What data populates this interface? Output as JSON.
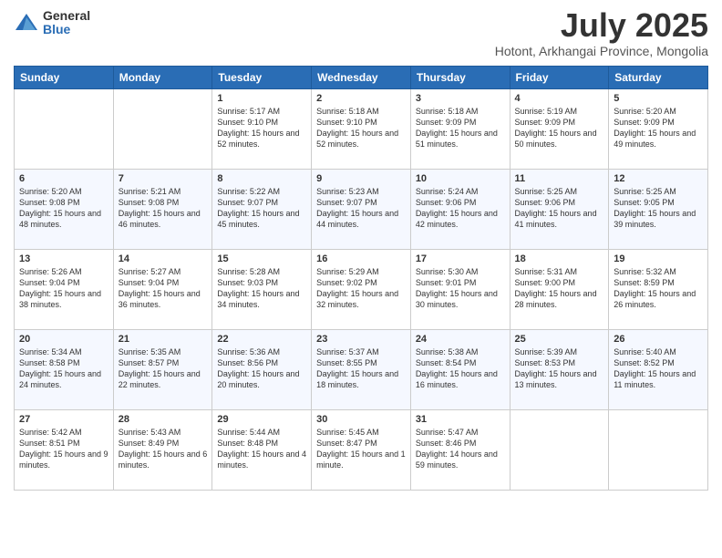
{
  "logo": {
    "general": "General",
    "blue": "Blue"
  },
  "title": {
    "month_year": "July 2025",
    "location": "Hotont, Arkhangai Province, Mongolia"
  },
  "weekdays": [
    "Sunday",
    "Monday",
    "Tuesday",
    "Wednesday",
    "Thursday",
    "Friday",
    "Saturday"
  ],
  "weeks": [
    [
      {
        "day": "",
        "info": ""
      },
      {
        "day": "",
        "info": ""
      },
      {
        "day": "1",
        "info": "Sunrise: 5:17 AM\nSunset: 9:10 PM\nDaylight: 15 hours and 52 minutes."
      },
      {
        "day": "2",
        "info": "Sunrise: 5:18 AM\nSunset: 9:10 PM\nDaylight: 15 hours and 52 minutes."
      },
      {
        "day": "3",
        "info": "Sunrise: 5:18 AM\nSunset: 9:09 PM\nDaylight: 15 hours and 51 minutes."
      },
      {
        "day": "4",
        "info": "Sunrise: 5:19 AM\nSunset: 9:09 PM\nDaylight: 15 hours and 50 minutes."
      },
      {
        "day": "5",
        "info": "Sunrise: 5:20 AM\nSunset: 9:09 PM\nDaylight: 15 hours and 49 minutes."
      }
    ],
    [
      {
        "day": "6",
        "info": "Sunrise: 5:20 AM\nSunset: 9:08 PM\nDaylight: 15 hours and 48 minutes."
      },
      {
        "day": "7",
        "info": "Sunrise: 5:21 AM\nSunset: 9:08 PM\nDaylight: 15 hours and 46 minutes."
      },
      {
        "day": "8",
        "info": "Sunrise: 5:22 AM\nSunset: 9:07 PM\nDaylight: 15 hours and 45 minutes."
      },
      {
        "day": "9",
        "info": "Sunrise: 5:23 AM\nSunset: 9:07 PM\nDaylight: 15 hours and 44 minutes."
      },
      {
        "day": "10",
        "info": "Sunrise: 5:24 AM\nSunset: 9:06 PM\nDaylight: 15 hours and 42 minutes."
      },
      {
        "day": "11",
        "info": "Sunrise: 5:25 AM\nSunset: 9:06 PM\nDaylight: 15 hours and 41 minutes."
      },
      {
        "day": "12",
        "info": "Sunrise: 5:25 AM\nSunset: 9:05 PM\nDaylight: 15 hours and 39 minutes."
      }
    ],
    [
      {
        "day": "13",
        "info": "Sunrise: 5:26 AM\nSunset: 9:04 PM\nDaylight: 15 hours and 38 minutes."
      },
      {
        "day": "14",
        "info": "Sunrise: 5:27 AM\nSunset: 9:04 PM\nDaylight: 15 hours and 36 minutes."
      },
      {
        "day": "15",
        "info": "Sunrise: 5:28 AM\nSunset: 9:03 PM\nDaylight: 15 hours and 34 minutes."
      },
      {
        "day": "16",
        "info": "Sunrise: 5:29 AM\nSunset: 9:02 PM\nDaylight: 15 hours and 32 minutes."
      },
      {
        "day": "17",
        "info": "Sunrise: 5:30 AM\nSunset: 9:01 PM\nDaylight: 15 hours and 30 minutes."
      },
      {
        "day": "18",
        "info": "Sunrise: 5:31 AM\nSunset: 9:00 PM\nDaylight: 15 hours and 28 minutes."
      },
      {
        "day": "19",
        "info": "Sunrise: 5:32 AM\nSunset: 8:59 PM\nDaylight: 15 hours and 26 minutes."
      }
    ],
    [
      {
        "day": "20",
        "info": "Sunrise: 5:34 AM\nSunset: 8:58 PM\nDaylight: 15 hours and 24 minutes."
      },
      {
        "day": "21",
        "info": "Sunrise: 5:35 AM\nSunset: 8:57 PM\nDaylight: 15 hours and 22 minutes."
      },
      {
        "day": "22",
        "info": "Sunrise: 5:36 AM\nSunset: 8:56 PM\nDaylight: 15 hours and 20 minutes."
      },
      {
        "day": "23",
        "info": "Sunrise: 5:37 AM\nSunset: 8:55 PM\nDaylight: 15 hours and 18 minutes."
      },
      {
        "day": "24",
        "info": "Sunrise: 5:38 AM\nSunset: 8:54 PM\nDaylight: 15 hours and 16 minutes."
      },
      {
        "day": "25",
        "info": "Sunrise: 5:39 AM\nSunset: 8:53 PM\nDaylight: 15 hours and 13 minutes."
      },
      {
        "day": "26",
        "info": "Sunrise: 5:40 AM\nSunset: 8:52 PM\nDaylight: 15 hours and 11 minutes."
      }
    ],
    [
      {
        "day": "27",
        "info": "Sunrise: 5:42 AM\nSunset: 8:51 PM\nDaylight: 15 hours and 9 minutes."
      },
      {
        "day": "28",
        "info": "Sunrise: 5:43 AM\nSunset: 8:49 PM\nDaylight: 15 hours and 6 minutes."
      },
      {
        "day": "29",
        "info": "Sunrise: 5:44 AM\nSunset: 8:48 PM\nDaylight: 15 hours and 4 minutes."
      },
      {
        "day": "30",
        "info": "Sunrise: 5:45 AM\nSunset: 8:47 PM\nDaylight: 15 hours and 1 minute."
      },
      {
        "day": "31",
        "info": "Sunrise: 5:47 AM\nSunset: 8:46 PM\nDaylight: 14 hours and 59 minutes."
      },
      {
        "day": "",
        "info": ""
      },
      {
        "day": "",
        "info": ""
      }
    ]
  ]
}
